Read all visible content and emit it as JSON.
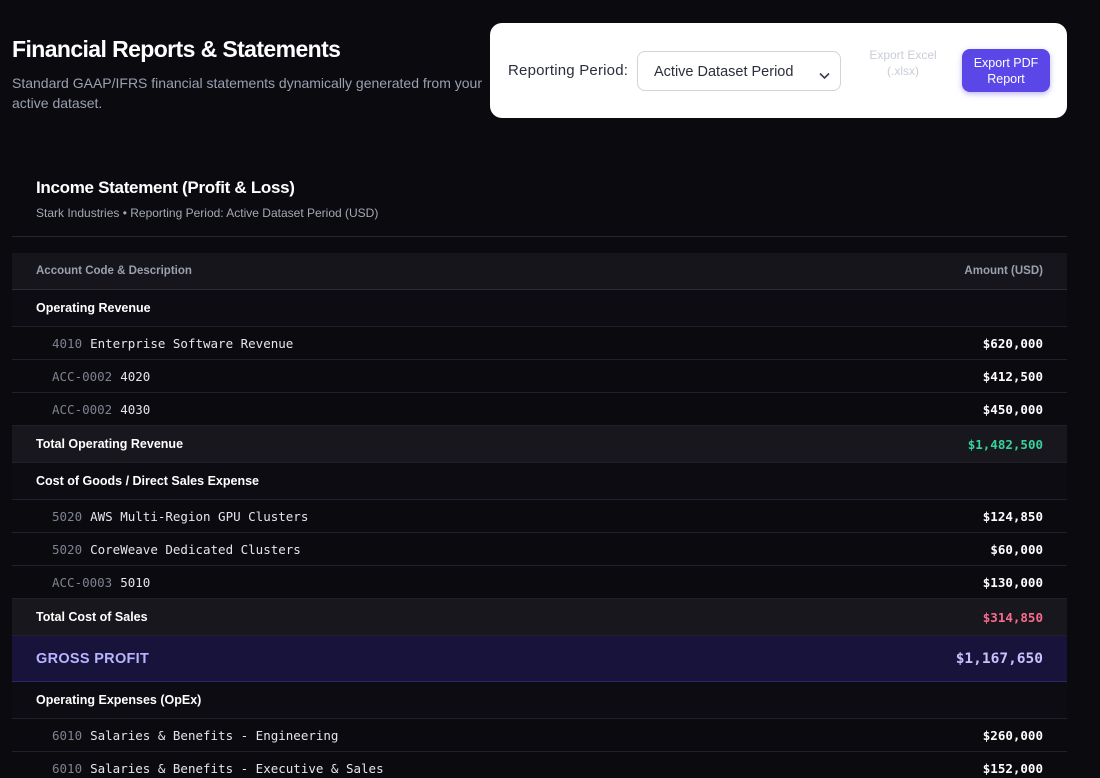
{
  "header": {
    "title": "Financial Reports & Statements",
    "subtitle": "Standard GAAP/IFRS financial statements dynamically generated from your active dataset."
  },
  "controls": {
    "period_label": "Reporting Period:",
    "period_value": "Active Dataset Period",
    "export_excel_label": "Export Excel (.xlsx)",
    "export_pdf_label": "Export PDF Report"
  },
  "statement": {
    "title": "Income Statement (Profit & Loss)",
    "subtitle": "Stark Industries • Reporting Period: Active Dataset Period (USD)",
    "columns": {
      "account": "Account Code & Description",
      "amount": "Amount (USD)"
    },
    "rows": [
      {
        "type": "section",
        "label": "Operating Revenue"
      },
      {
        "type": "item",
        "code": "4010",
        "desc": "Enterprise Software Revenue",
        "amount": "$620,000"
      },
      {
        "type": "item",
        "code": "ACC-0002",
        "desc": "4020",
        "amount": "$412,500"
      },
      {
        "type": "item",
        "code": "ACC-0002",
        "desc": "4030",
        "amount": "$450,000"
      },
      {
        "type": "total",
        "label": "Total Operating Revenue",
        "amount": "$1,482,500"
      },
      {
        "type": "section",
        "label": "Cost of Goods / Direct Sales Expense"
      },
      {
        "type": "item",
        "code": "5020",
        "desc": "AWS Multi-Region GPU Clusters",
        "amount": "$124,850"
      },
      {
        "type": "item",
        "code": "5020",
        "desc": "CoreWeave Dedicated Clusters",
        "amount": "$60,000"
      },
      {
        "type": "item",
        "code": "ACC-0003",
        "desc": "5010",
        "amount": "$130,000"
      },
      {
        "type": "total",
        "label": "Total Cost of Sales",
        "amount": "$314,850"
      },
      {
        "type": "gross",
        "label": "GROSS PROFIT",
        "amount": "$1,167,650"
      },
      {
        "type": "section",
        "label": "Operating Expenses (OpEx)"
      },
      {
        "type": "item",
        "code": "6010",
        "desc": "Salaries & Benefits - Engineering",
        "amount": "$260,000"
      },
      {
        "type": "item",
        "code": "6010",
        "desc": "Salaries & Benefits - Executive & Sales",
        "amount": "$152,000"
      }
    ]
  },
  "colors": {
    "accent": "#5b46e8",
    "positive": "#34d399",
    "negative": "#fb6b8e",
    "gross": "#c7c2ff"
  }
}
